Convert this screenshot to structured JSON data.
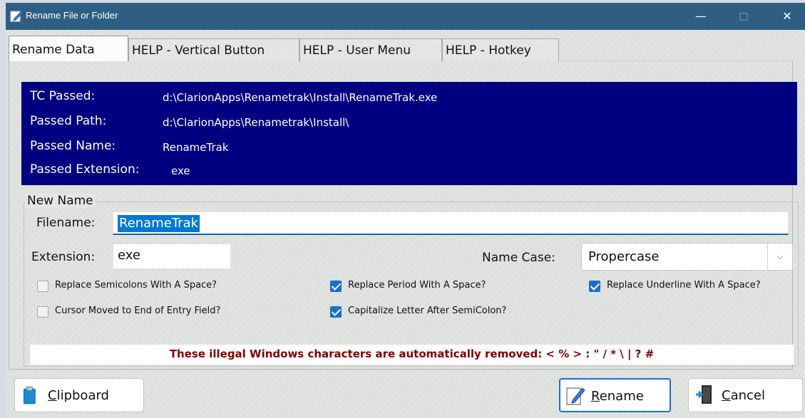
{
  "window": {
    "title": "Rename File or Folder",
    "minimize": "—",
    "maximize": "□",
    "close": "✕"
  },
  "tabs": [
    {
      "label": "Rename Data",
      "active": true
    },
    {
      "label": "HELP - Vertical Button",
      "active": false
    },
    {
      "label": "HELP - User Menu",
      "active": false
    },
    {
      "label": "HELP - Hotkey",
      "active": false
    }
  ],
  "info": {
    "tc_passed_label": "TC Passed:",
    "tc_passed_value": "d:\\ClarionApps\\Renametrak\\Install\\RenameTrak.exe",
    "path_label": "Passed Path:",
    "path_value": "d:\\ClarionApps\\Renametrak\\Install\\",
    "name_label": "Passed Name:",
    "name_value": "RenameTrak",
    "ext_label": "Passed Extension:",
    "ext_value": "exe"
  },
  "new_name": {
    "legend": "New Name",
    "filename_label": "Filename:",
    "filename_value": "RenameTrak",
    "extension_label": "Extension:",
    "extension_value": "exe",
    "name_case_label": "Name Case:",
    "name_case_value": "Propercase"
  },
  "checkboxes": [
    {
      "label": "Replace Semicolons With A Space?",
      "checked": false
    },
    {
      "label": "Replace Period With A Space?",
      "checked": true
    },
    {
      "label": "Replace Underline With A Space?",
      "checked": true
    },
    {
      "label": "Cursor Moved to End of Entry Field?",
      "checked": false
    },
    {
      "label": "Capitalize Letter After SemiColon?",
      "checked": true
    }
  ],
  "notice": "These illegal Windows characters are automatically removed:  < % > : \" / * \\ | ? #",
  "buttons": {
    "clipboard": "Clipboard",
    "rename": "Rename",
    "cancel": "Cancel"
  },
  "colors": {
    "titlebar": "#2e5f83",
    "info_background": "#000080",
    "notice_text": "#800000",
    "accent": "#1a6ecf"
  }
}
